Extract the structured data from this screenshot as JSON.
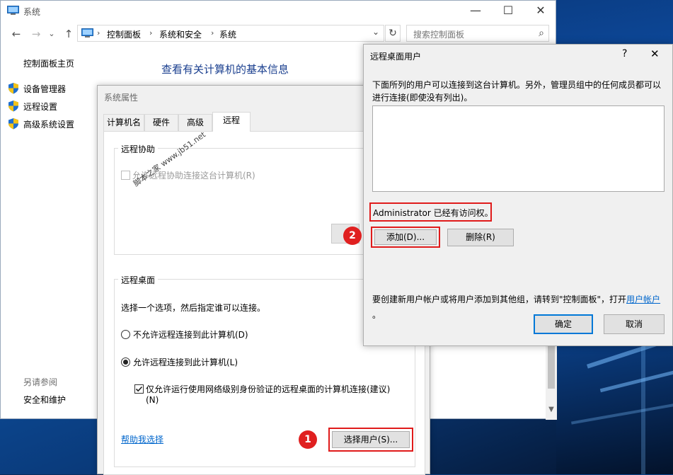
{
  "window": {
    "title": "系统",
    "min_glyph": "—",
    "max_glyph": "☐",
    "close_glyph": "✕"
  },
  "toolbar": {
    "back_glyph": "←",
    "forward_glyph": "→",
    "history_glyph": "⌄",
    "up_glyph": "↑",
    "refresh_glyph": "↻",
    "dropdown_glyph": "⌄",
    "search_glyph": "⌕"
  },
  "address": {
    "parts": [
      "控制面板",
      "系统和安全",
      "系统"
    ],
    "separator": "›"
  },
  "search": {
    "placeholder": "搜索控制面板"
  },
  "sidebar": {
    "home": "控制面板主页",
    "items": [
      {
        "label": "设备管理器",
        "icon": "shield-icon"
      },
      {
        "label": "远程设置",
        "icon": "shield-icon"
      },
      {
        "label": "高级系统设置",
        "icon": "shield-icon"
      }
    ],
    "see_also": "另请参阅",
    "security_link": "安全和维护"
  },
  "main": {
    "heading": "查看有关计算机的基本信息"
  },
  "system_properties": {
    "title": "系统属性",
    "tabs": [
      "计算机名",
      "硬件",
      "高级",
      "远程"
    ],
    "active_tab": 3,
    "remote_assistance": {
      "group_title": "远程协助",
      "checkbox_label": "允许远程协助连接这台计算机(R)",
      "checkbox_checked": false,
      "checkbox_enabled": false
    },
    "remote_desktop": {
      "group_title": "远程桌面",
      "instruction": "选择一个选项，然后指定谁可以连接。",
      "option_deny": "不允许远程连接到此计算机(D)",
      "option_allow": "允许远程连接到此计算机(L)",
      "selected": "allow",
      "nla_label_line1": "仅允许运行使用网络级别身份验证的远程桌面的计算机连接(建议)",
      "nla_label_line2": "(N)",
      "nla_checked": true,
      "help_link": "帮助我选择",
      "select_users_button": "选择用户(S)..."
    }
  },
  "remote_desktop_users": {
    "title": "远程桌面用户",
    "help_glyph": "?",
    "close_glyph": "✕",
    "description": "下面所列的用户可以连接到这台计算机。另外，管理员组中的任何成员都可以进行连接(即使没有列出)。",
    "users": [],
    "access_note": "Administrator 已经有访问权。",
    "add_button": "添加(D)...",
    "remove_button": "删除(R)",
    "create_note_prefix": "要创建新用户帐户或将用户添加到其他组，请转到\"控制面板\"，打开",
    "create_note_link": "用户帐户",
    "create_note_suffix": "。",
    "ok_button": "确定",
    "cancel_button": "取消"
  },
  "annotations": {
    "badge1": "1",
    "badge2": "2"
  },
  "watermark": "脚本之家 www.jb51.net",
  "colors": {
    "heading": "#1a3f8f",
    "link": "#0066cc",
    "highlight": "#e01b1b",
    "badge": "#e02020"
  }
}
